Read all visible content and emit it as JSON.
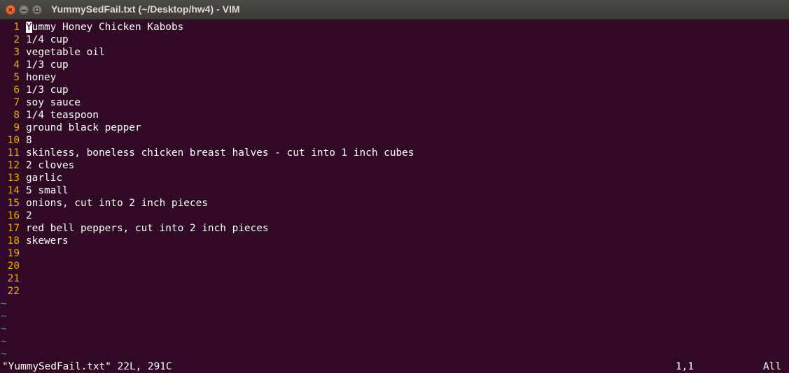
{
  "window": {
    "title": "YummySedFail.txt (~/Desktop/hw4) - VIM"
  },
  "buffer": {
    "lines": [
      {
        "num": "1",
        "text": "Yummy Honey Chicken Kabobs"
      },
      {
        "num": "2",
        "text": "1/4 cup"
      },
      {
        "num": "3",
        "text": "vegetable oil"
      },
      {
        "num": "4",
        "text": "1/3 cup"
      },
      {
        "num": "5",
        "text": "honey"
      },
      {
        "num": "6",
        "text": "1/3 cup"
      },
      {
        "num": "7",
        "text": "soy sauce"
      },
      {
        "num": "8",
        "text": "1/4 teaspoon"
      },
      {
        "num": "9",
        "text": "ground black pepper"
      },
      {
        "num": "10",
        "text": "8"
      },
      {
        "num": "11",
        "text": "skinless, boneless chicken breast halves - cut into 1 inch cubes"
      },
      {
        "num": "12",
        "text": "2 cloves"
      },
      {
        "num": "13",
        "text": "garlic"
      },
      {
        "num": "14",
        "text": "5 small"
      },
      {
        "num": "15",
        "text": "onions, cut into 2 inch pieces"
      },
      {
        "num": "16",
        "text": "2"
      },
      {
        "num": "17",
        "text": "red bell peppers, cut into 2 inch pieces"
      },
      {
        "num": "18",
        "text": "skewers"
      },
      {
        "num": "19",
        "text": ""
      },
      {
        "num": "20",
        "text": ""
      },
      {
        "num": "21",
        "text": ""
      },
      {
        "num": "22",
        "text": ""
      }
    ],
    "filler": [
      "~",
      "~",
      "~",
      "~",
      "~"
    ]
  },
  "status": {
    "message": "\"YummySedFail.txt\" 22L, 291C",
    "position": "1,1",
    "scroll": "All"
  },
  "colors": {
    "background": "#300a24",
    "line_number": "#e9ad0c",
    "text": "#ffffff",
    "tilde": "#5f87d7"
  }
}
